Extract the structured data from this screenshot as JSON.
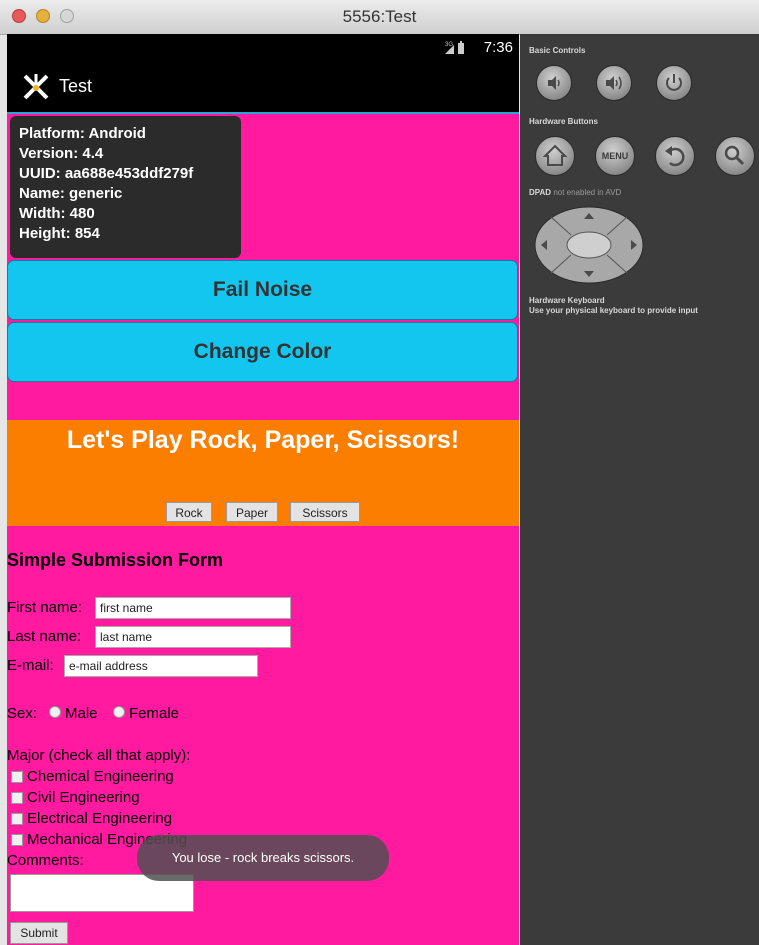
{
  "window": {
    "title": "5556:Test"
  },
  "status_bar": {
    "time": "7:36"
  },
  "action_bar": {
    "app_title": "Test"
  },
  "device_info": [
    "Platform: Android",
    "Version: 4.4",
    "UUID: aa688e453ddf279f",
    "Name: generic",
    "Width: 480",
    "Height: 854"
  ],
  "buttons": {
    "fail_noise": "Fail Noise",
    "change_color": "Change Color"
  },
  "rps": {
    "title": "Let's Play Rock, Paper, Scissors!",
    "rock": "Rock",
    "paper": "Paper",
    "scissors": "Scissors"
  },
  "form": {
    "title": "Simple Submission Form",
    "first_name_label": "First name:",
    "first_name_value": "first name",
    "last_name_label": "Last name:",
    "last_name_value": "last name",
    "email_label": "E-mail:",
    "email_value": "e-mail address",
    "sex_label": "Sex:",
    "sex_options": [
      "Male",
      "Female"
    ],
    "major_label": "Major (check all that apply):",
    "majors": [
      "Chemical Engineering",
      "Civil Engineering",
      "Electrical Engineering",
      "Mechanical Engineering"
    ],
    "comments_label": "Comments:",
    "submit_label": "Submit"
  },
  "toast": "You lose - rock breaks scissors.",
  "colors": {
    "page_background": "#ff1aa0",
    "button_background": "#12c6f0",
    "rps_background": "#fc7e00",
    "panel_background": "#3b3b3b"
  },
  "controls_panel": {
    "basic_controls_label": "Basic Controls",
    "hardware_buttons_label": "Hardware Buttons",
    "menu_label": "MENU",
    "dpad_label": "DPAD",
    "dpad_note": "not enabled in AVD",
    "keyboard_label": "Hardware Keyboard",
    "keyboard_note": "Use your physical keyboard to provide input",
    "icons": [
      "volume-down-icon",
      "volume-up-icon",
      "power-icon",
      "home-icon",
      "menu-button",
      "back-icon",
      "search-icon"
    ]
  }
}
